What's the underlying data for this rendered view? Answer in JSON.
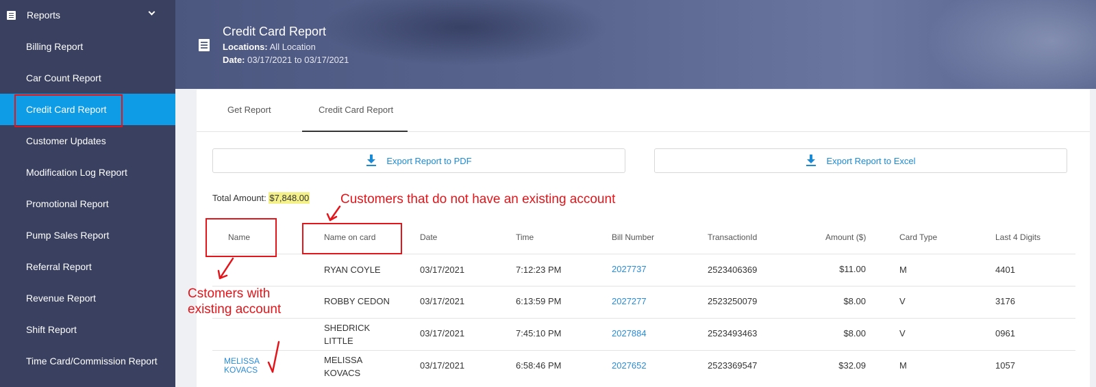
{
  "sidebar": {
    "section_label": "Reports",
    "items": [
      {
        "label": "Billing Report"
      },
      {
        "label": "Car Count Report"
      },
      {
        "label": "Credit Card Report",
        "active": true
      },
      {
        "label": "Customer Updates"
      },
      {
        "label": "Modification Log Report"
      },
      {
        "label": "Promotional Report"
      },
      {
        "label": "Pump Sales Report"
      },
      {
        "label": "Referral Report"
      },
      {
        "label": "Revenue Report"
      },
      {
        "label": "Shift Report"
      },
      {
        "label": "Time Card/Commission Report"
      }
    ]
  },
  "header": {
    "title": "Credit Card Report",
    "locations_label": "Locations:",
    "locations_value": "All Location",
    "date_label": "Date:",
    "date_value": "03/17/2021 to 03/17/2021"
  },
  "tabs": [
    {
      "label": "Get Report"
    },
    {
      "label": "Credit Card Report",
      "active": true
    }
  ],
  "export": {
    "pdf_label": "Export Report to PDF",
    "excel_label": "Export Report to Excel"
  },
  "summary": {
    "total_label": "Total Amount:",
    "total_value": "$7,848.00"
  },
  "table": {
    "columns": [
      "Name",
      "Name on card",
      "Date",
      "Time",
      "Bill Number",
      "TransactionId",
      "Amount ($)",
      "Card Type",
      "Last 4 Digits"
    ],
    "rows": [
      {
        "name": "",
        "name_on_card": "RYAN COYLE",
        "date": "03/17/2021",
        "time": "7:12:23 PM",
        "bill": "2027737",
        "txn": "2523406369",
        "amount": "$11.00",
        "card_type": "M",
        "last4": "4401"
      },
      {
        "name": "",
        "name_on_card": "ROBBY CEDON",
        "date": "03/17/2021",
        "time": "6:13:59 PM",
        "bill": "2027277",
        "txn": "2523250079",
        "amount": "$8.00",
        "card_type": "V",
        "last4": "3176"
      },
      {
        "name": "",
        "name_on_card": "SHEDRICK LITTLE",
        "date": "03/17/2021",
        "time": "7:45:10 PM",
        "bill": "2027884",
        "txn": "2523493463",
        "amount": "$8.00",
        "card_type": "V",
        "last4": "0961"
      },
      {
        "name": "MELISSA KOVACS",
        "name_on_card": "MELISSA KOVACS",
        "date": "03/17/2021",
        "time": "6:58:46 PM",
        "bill": "2027652",
        "txn": "2523369547",
        "amount": "$32.09",
        "card_type": "M",
        "last4": "1057"
      }
    ]
  },
  "annotations": {
    "no_account": "Customers that do not have an existing account",
    "with_account_line1": "Cstomers with",
    "with_account_line2": "existing account",
    "color": "#e3151a"
  }
}
